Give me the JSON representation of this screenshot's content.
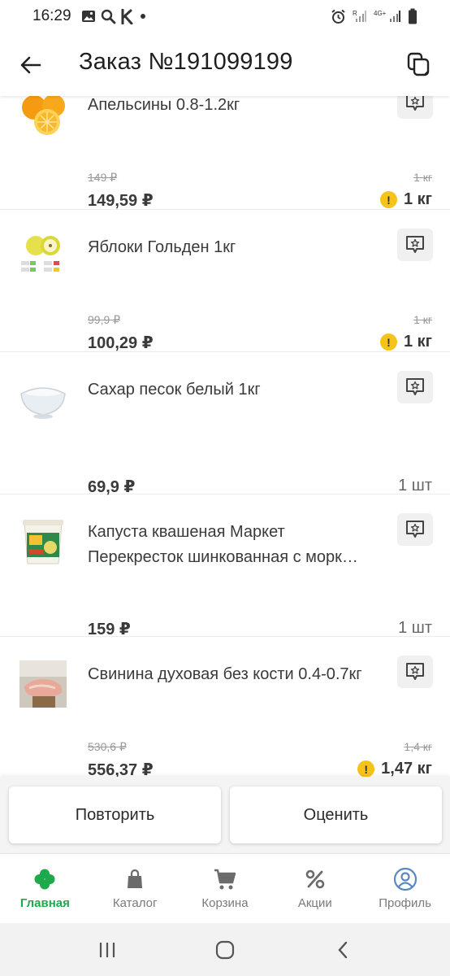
{
  "status_bar": {
    "time": "16:29"
  },
  "header": {
    "title": "Заказ №191099199"
  },
  "products": [
    {
      "name": "Апельсины 0.8-1.2кг",
      "old_price": "149 ₽",
      "price": "149,59 ₽",
      "old_qty": "1 кг",
      "qty": "1 кг",
      "warning": true,
      "image": "oranges-image"
    },
    {
      "name": "Яблоки Гольден 1кг",
      "old_price": "99,9 ₽",
      "price": "100,29 ₽",
      "old_qty": "1 кг",
      "qty": "1 кг",
      "warning": true,
      "image": "apples-image"
    },
    {
      "name": "Сахар песок белый 1кг",
      "old_price": "",
      "price": "69,9 ₽",
      "old_qty": "",
      "qty": "1 шт",
      "warning": false,
      "image": "sugar-image"
    },
    {
      "name": "Капуста квашеная Маркет Перекресток шинкованная с морк…",
      "old_price": "",
      "price": "159 ₽",
      "old_qty": "",
      "qty": "1 шт",
      "warning": false,
      "image": "sauerkraut-image"
    },
    {
      "name": "Свинина духовая без кости 0.4-0.7кг",
      "old_price": "530,6 ₽",
      "price": "556,37 ₽",
      "old_qty": "1,4 кг",
      "qty": "1,47 кг",
      "warning": true,
      "image": "pork-image"
    }
  ],
  "actions": {
    "repeat": "Повторить",
    "rate": "Оценить"
  },
  "nav": [
    {
      "label": "Главная",
      "icon": "clover-icon",
      "active": true
    },
    {
      "label": "Каталог",
      "icon": "bag-icon",
      "active": false
    },
    {
      "label": "Корзина",
      "icon": "cart-icon",
      "active": false
    },
    {
      "label": "Акции",
      "icon": "percent-icon",
      "active": false
    },
    {
      "label": "Профиль",
      "icon": "profile-icon",
      "active": false
    }
  ],
  "colors": {
    "accent": "#1ea94a",
    "warning": "#f6c31a",
    "text": "#3a3a3a",
    "muted": "#9a9a9a"
  }
}
